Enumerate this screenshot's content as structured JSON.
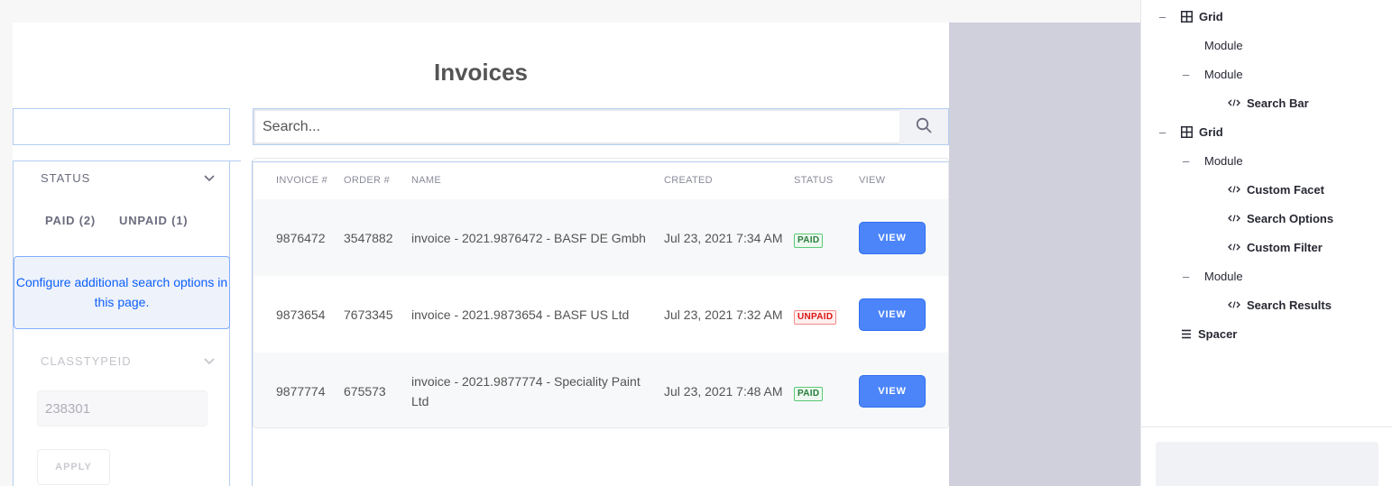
{
  "page": {
    "title": "Invoices"
  },
  "search": {
    "placeholder": "Search..."
  },
  "facets": {
    "status": {
      "heading": "STATUS",
      "options": [
        "PAID (2)",
        "UNPAID (1)"
      ]
    },
    "config_message": "Configure additional search options in this page.",
    "classtype": {
      "heading": "CLASSTYPEID",
      "placeholder": "238301",
      "apply_label": "APPLY"
    }
  },
  "table": {
    "columns": [
      "INVOICE #",
      "ORDER #",
      "NAME",
      "CREATED",
      "STATUS",
      "VIEW"
    ],
    "rows": [
      {
        "invoice": "9876472",
        "order": "3547882",
        "name": "invoice - 2021.9876472 - BASF DE Gmbh",
        "created": "Jul 23, 2021 7:34 AM",
        "status": "PAID",
        "view": "VIEW"
      },
      {
        "invoice": "9873654",
        "order": "7673345",
        "name": "invoice - 2021.9873654 - BASF US Ltd",
        "created": "Jul 23, 2021 7:32 AM",
        "status": "UNPAID",
        "view": "VIEW"
      },
      {
        "invoice": "9877774",
        "order": "675573",
        "name": "invoice - 2021.9877774 - Speciality Paint Ltd",
        "created": "Jul 23, 2021 7:48 AM",
        "status": "PAID",
        "view": "VIEW"
      }
    ]
  },
  "colors": {
    "accent": "#4c85fa",
    "paid": "#287d3c",
    "unpaid": "#da1414",
    "link": "#0b5fff"
  },
  "structure_tree": {
    "items": [
      {
        "label": "Grid",
        "icon": "grid-icon",
        "bold": true
      },
      {
        "label": "Module",
        "icon": "",
        "bold": false
      },
      {
        "label": "Module",
        "icon": "",
        "bold": false
      },
      {
        "label": "Search Bar",
        "icon": "code-icon",
        "bold": true
      },
      {
        "label": "Grid",
        "icon": "grid-icon",
        "bold": true
      },
      {
        "label": "Module",
        "icon": "",
        "bold": false
      },
      {
        "label": "Custom Facet",
        "icon": "code-icon",
        "bold": true
      },
      {
        "label": "Search Options",
        "icon": "code-icon",
        "bold": true
      },
      {
        "label": "Custom Filter",
        "icon": "code-icon",
        "bold": true
      },
      {
        "label": "Module",
        "icon": "",
        "bold": false
      },
      {
        "label": "Search Results",
        "icon": "code-icon",
        "bold": true
      },
      {
        "label": "Spacer",
        "icon": "spacer-icon",
        "bold": true
      }
    ]
  }
}
